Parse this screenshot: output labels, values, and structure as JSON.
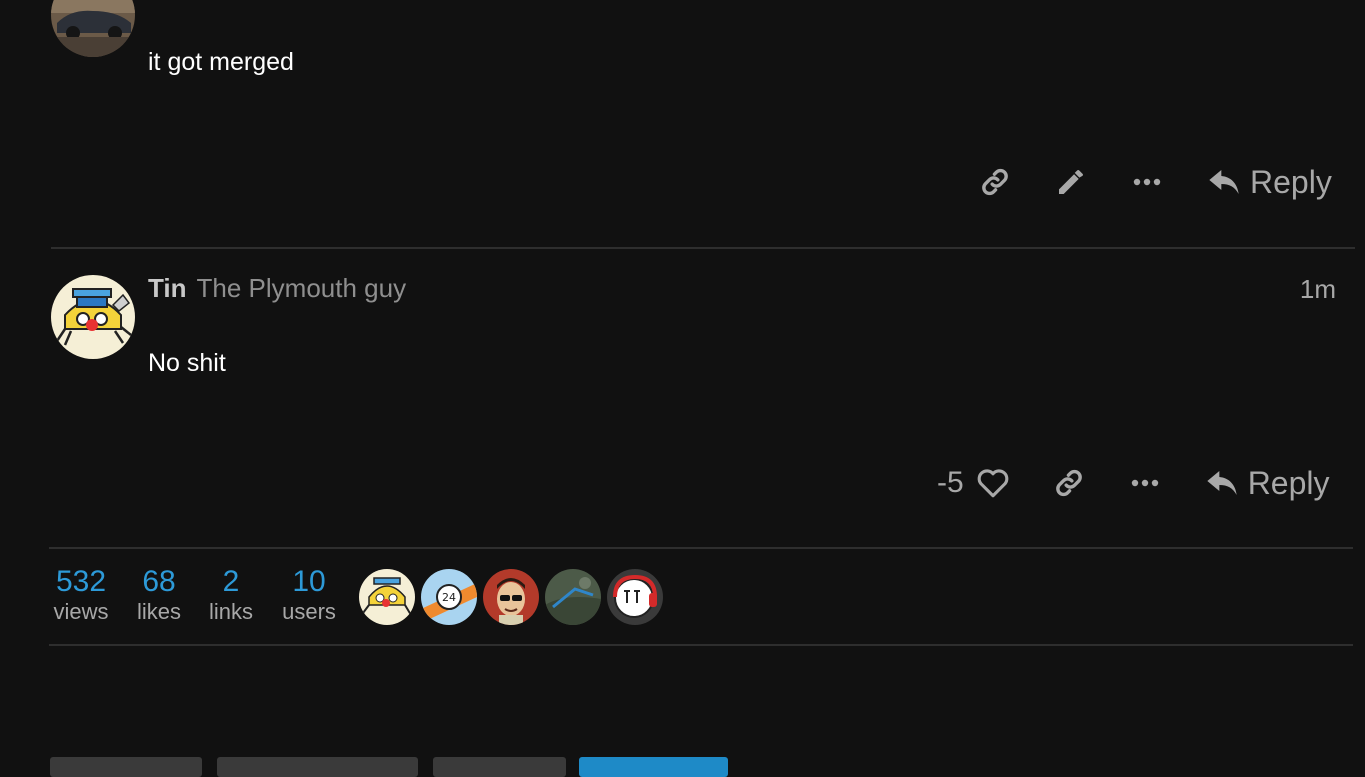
{
  "posts": [
    {
      "body": "it got merged",
      "actions": {
        "reply_label": "Reply"
      }
    },
    {
      "username": "Tin",
      "user_title": "The Plymouth guy",
      "time": "1m",
      "body": "No shit",
      "like_count": "-5",
      "actions": {
        "reply_label": "Reply"
      }
    }
  ],
  "summary": {
    "stats": [
      {
        "num": "532",
        "label": "views"
      },
      {
        "num": "68",
        "label": "likes"
      },
      {
        "num": "2",
        "label": "links"
      },
      {
        "num": "10",
        "label": "users"
      }
    ],
    "participants": [
      "tin-avatar",
      "24-badge-avatar",
      "sunglasses-man-avatar",
      "landscape-avatar",
      "headset-avatar"
    ]
  },
  "colors": {
    "accent": "#2d9ad8",
    "background": "#111111",
    "primary_button": "#1e8ac7"
  }
}
